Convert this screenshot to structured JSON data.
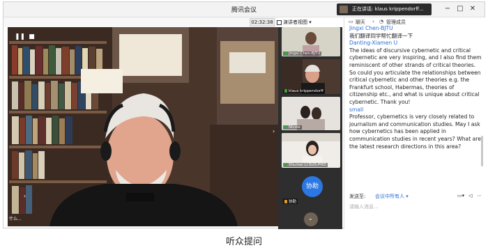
{
  "titlebar": {
    "app_title": "腾讯会议",
    "speaking_text": "正在讲话: klaus krippendorff...",
    "window_controls": [
      "−",
      "□",
      "✕"
    ]
  },
  "toolbar": {
    "timer": "02:32:38",
    "view_label": "演讲者视图",
    "pause_icon": "pause-icon",
    "stop_icon": "stop-icon"
  },
  "participants": [
    {
      "name": "Jingxi Chen-BJTU"
    },
    {
      "name": "klaus krippendorff"
    },
    {
      "name": "Nicole"
    },
    {
      "name": "Shumei Li-SUS-PHD"
    },
    {
      "name": "协助"
    }
  ],
  "assist_button": "协助",
  "main_video_label": "什么...",
  "chat": {
    "tab_chat": "聊天",
    "tab_members": "管理成员",
    "messages": [
      {
        "sender": "Jingxi Chen-BJTU",
        "text": "我们翻译同学帮忙翻译一下"
      },
      {
        "sender": "Danting-Xiamen U",
        "text": "The ideas of discursive cybernetic and critical cybernetic are very inspiring, and I also find them reminiscent of other strands of critical theories. So could you articulate the relationships between critical cybernetic and other theories e.g. the Frankfurt school, Habermas, theories of citizenship etc., and what is unique about critical cybernetic. Thank you!"
      },
      {
        "sender": "small",
        "text": "Professor, cybernetics is very closely related to journalism and communication studies. May I ask how cybernetics has been applied in communication studies in recent years? What are the latest research directions in this area?"
      }
    ],
    "send_to_label": "发送至:",
    "send_to_value": "会议中所有人",
    "input_placeholder": "请输入消息..."
  },
  "caption": "听众提问",
  "colors": {
    "accent": "#2b78e4",
    "sender": "#2b6fd6"
  }
}
